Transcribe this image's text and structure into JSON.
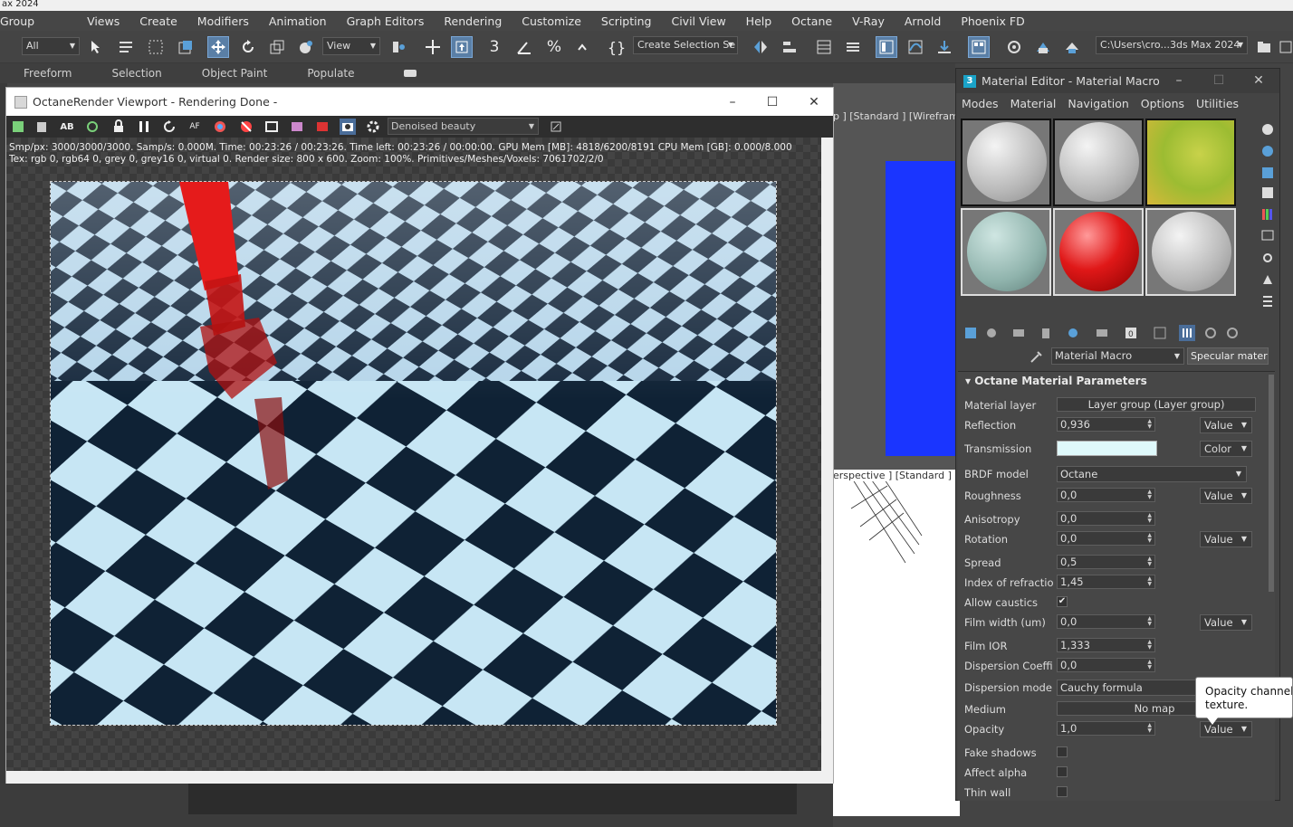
{
  "app": {
    "title": "ax 2024",
    "menu": [
      "Group",
      "Views",
      "Create",
      "Modifiers",
      "Animation",
      "Graph Editors",
      "Rendering",
      "Customize",
      "Scripting",
      "Civil View",
      "Help",
      "Octane",
      "V-Ray",
      "Arnold",
      "Phoenix FD"
    ]
  },
  "toolbar": {
    "selection_filter": "All",
    "reference_coord": "View",
    "named_selection": "Create Selection Se",
    "project_path": "C:\\Users\\cro...3ds Max 2024"
  },
  "ribbon": {
    "tabs": [
      "Freeform",
      "Selection",
      "Object Paint",
      "Populate"
    ]
  },
  "viewports": {
    "top_right_label": "p ] [Standard ] [Wireframe",
    "bottom_right_label": "erspective ] [Standard ] [De"
  },
  "octane_window": {
    "title": "OctaneRender Viewport - Rendering Done -",
    "channel": "Denoised beauty",
    "stats_line1": "Smp/px: 3000/3000/3000.   Samp/s: 0.000M.   Time: 00:23:26 / 00:23:26.   Time left: 00:23:26 / 00:00:00.   GPU Mem [MB]: 4818/6200/8191   CPU Mem [GB]: 0.000/8.000",
    "stats_line2": "Tex: rgb 0, rgb64 0, grey 0, grey16 0, virtual 0.   Render size: 800 x 600.   Zoom: 100%.   Primitives/Meshes/Voxels: 7061702/2/0"
  },
  "material_editor": {
    "title": "Material Editor - Material Macro",
    "menu": [
      "Modes",
      "Material",
      "Navigation",
      "Options",
      "Utilities"
    ],
    "material_name": "Material Macro",
    "material_type": "Specular material",
    "rollout_title": "Octane Material Parameters",
    "params": {
      "material_layer": {
        "label": "Material layer",
        "value": "Layer group (Layer group)"
      },
      "reflection": {
        "label": "Reflection",
        "value": "0,936",
        "type": "Value"
      },
      "transmission": {
        "label": "Transmission",
        "type": "Color",
        "color": "#dff9fb"
      },
      "brdf": {
        "label": "BRDF model",
        "value": "Octane"
      },
      "roughness": {
        "label": "Roughness",
        "value": "0,0",
        "type": "Value"
      },
      "anisotropy": {
        "label": "Anisotropy",
        "value": "0,0"
      },
      "rotation": {
        "label": "Rotation",
        "value": "0,0",
        "type": "Value"
      },
      "spread": {
        "label": "Spread",
        "value": "0,5"
      },
      "ior": {
        "label": "Index of refraction",
        "value": "1,45"
      },
      "allow_caustics": {
        "label": "Allow caustics",
        "checked": "✔"
      },
      "film_width": {
        "label": "Film width (um)",
        "value": "0,0",
        "type": "Value"
      },
      "film_ior": {
        "label": "Film IOR",
        "value": "1,333"
      },
      "dispersion_coef": {
        "label": "Dispersion Coeffici…",
        "value": "0,0"
      },
      "dispersion_mode": {
        "label": "Dispersion mode",
        "value": "Cauchy formula"
      },
      "medium": {
        "label": "Medium",
        "value": "No map"
      },
      "opacity": {
        "label": "Opacity",
        "value": "1,0",
        "type": "Value"
      },
      "fake_shadows": {
        "label": "Fake shadows"
      },
      "affect_alpha": {
        "label": "Affect alpha"
      },
      "thin_wall": {
        "label": "Thin wall"
      }
    },
    "tooltip": "Opacity channel co\ntexture."
  },
  "colors": {
    "accent_blue": "#5a7fa6",
    "viewport_blue": "#1a35ff",
    "sphere_red": "#e01818"
  }
}
